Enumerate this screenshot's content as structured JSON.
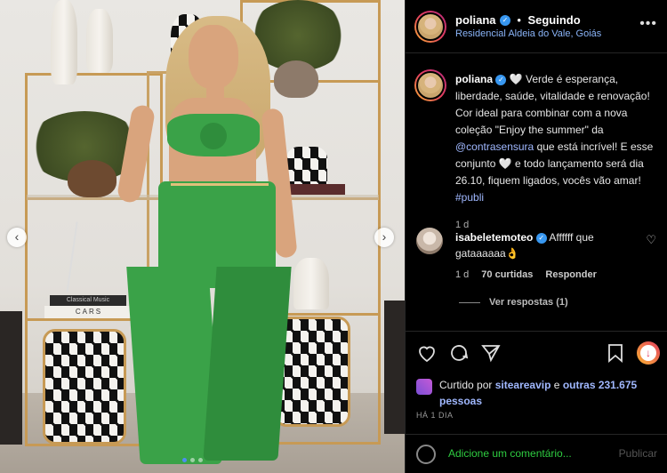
{
  "post": {
    "username": "poliana",
    "follow_separator": "•",
    "follow_label": "Seguindo",
    "location": "Residencial Aldeia do Vale, Goiás",
    "more_icon": "•••"
  },
  "caption": {
    "username": "poliana",
    "heart": "🤍",
    "text_1": "Verde é esperança, liberdade, saúde, vitalidade e renovação! Cor ideal para combinar com a nova coleção \"Enjoy the summer\" da",
    "mention": "@contrasensura",
    "text_2": "que está incrível! E esse conjunto",
    "heart_2": "🤍",
    "text_3": "e todo lançamento será dia 26.10, fiquem ligados, vocês vão amar!",
    "hashtag": "#publi",
    "time": "1 d"
  },
  "comment": {
    "username": "isabeletemoteo",
    "text": "Affffff que gataaaaaa👌",
    "time": "1 d",
    "likes": "70 curtidas",
    "reply_label": "Responder",
    "view_replies": "Ver respostas (1)",
    "heart_icon": "♡"
  },
  "likes": {
    "prefix": "Curtido por",
    "user": "siteareavip",
    "and": "e",
    "others": "outras 231.675 pessoas"
  },
  "posted_ago": "HÁ 1 DIA",
  "add_comment": {
    "placeholder": "Adicione um comentário...",
    "publish_label": "Publicar"
  },
  "photo": {
    "book_label_1": "Classical Music",
    "book_label_2": "CARS",
    "arrow_left": "‹",
    "arrow_right": "›"
  }
}
